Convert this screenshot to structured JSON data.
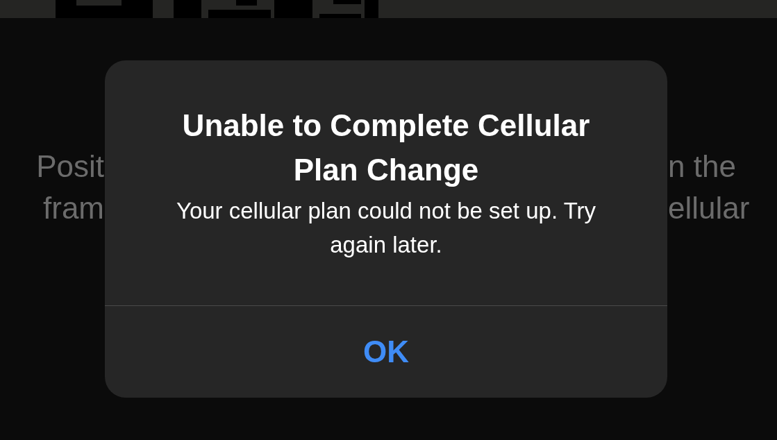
{
  "background_text": {
    "left_lines": [
      "Posit",
      "fram"
    ],
    "right_lines": [
      "n the",
      "ellular"
    ]
  },
  "alert": {
    "title": "Unable to Complete Cellular Plan Change",
    "message": "Your cellular plan could not be set up. Try again later.",
    "buttons": [
      {
        "label": "OK"
      }
    ]
  }
}
